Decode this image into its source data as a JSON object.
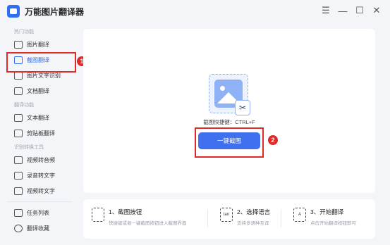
{
  "app": {
    "title": "万能图片翻译器"
  },
  "window_controls": {
    "menu": "☰",
    "minimize": "—",
    "maximize": "☐",
    "close": "✕"
  },
  "sidebar": {
    "sections": [
      {
        "heading": "热门功能",
        "items": [
          {
            "label": "图片翻译",
            "icon": "image-icon"
          },
          {
            "label": "截图翻译",
            "icon": "screenshot-icon",
            "active": true
          },
          {
            "label": "图片文字识别",
            "icon": "ocr-icon"
          },
          {
            "label": "文档翻译",
            "icon": "document-icon"
          }
        ]
      },
      {
        "heading": "翻译功能",
        "items": [
          {
            "label": "文本翻译",
            "icon": "text-icon"
          },
          {
            "label": "剪贴板翻译",
            "icon": "clipboard-icon"
          }
        ]
      },
      {
        "heading": "识别转换工具",
        "items": [
          {
            "label": "视频转音频",
            "icon": "video-audio-icon"
          },
          {
            "label": "录音转文字",
            "icon": "record-text-icon"
          },
          {
            "label": "视频转文字",
            "icon": "video-text-icon"
          }
        ]
      }
    ],
    "bottom_items": [
      {
        "label": "任务列表",
        "icon": "task-list-icon"
      },
      {
        "label": "翻译收藏",
        "icon": "star-icon"
      }
    ]
  },
  "annotations": {
    "one": "1",
    "two": "2"
  },
  "main": {
    "shortcut_text": "截图快捷键：CTRL+F",
    "cta_label": "一键截图"
  },
  "steps": [
    {
      "title": "1、截图按钮",
      "desc": "快捷键或者一键截图按钮进入截图界面",
      "icon_text": ""
    },
    {
      "title": "2、选择语言",
      "desc": "支持多语种互译",
      "icon_text": "lan"
    },
    {
      "title": "3、开始翻译",
      "desc": "点击开始翻译按钮即可",
      "icon_text": "A"
    }
  ],
  "colors": {
    "accent": "#4070ee",
    "annotation": "#e02a2a",
    "background": "#f3f5f9"
  }
}
